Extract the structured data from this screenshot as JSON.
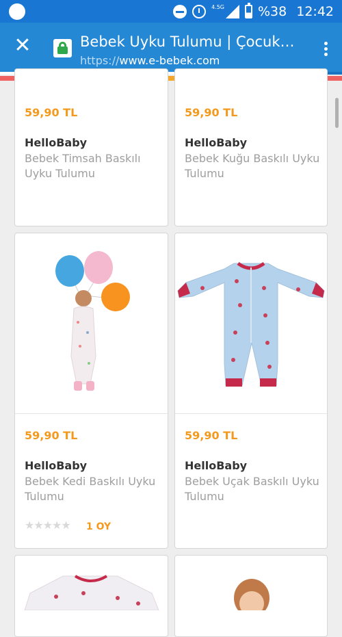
{
  "status_bar": {
    "network": "4.5G",
    "battery": "%38",
    "time": "12:42"
  },
  "browser": {
    "title": "Bebek Uyku Tulumu | Çocuk Uyku Tulumu",
    "url_scheme": "https://",
    "url_host": "www.e-bebek.com",
    "load_progress": 0.71,
    "close_icon": "close-icon",
    "menu_icon": "more-vertical-icon",
    "lock_icon": "lock-icon"
  },
  "brand_colors": {
    "accent_bar": [
      "#f06262",
      "#f06262",
      "#f4a72a",
      "#f06262"
    ],
    "price": "#f39a1e",
    "app_bar": "#2588d4"
  },
  "products": [
    {
      "price": "59,90 TL",
      "brand": "HelloBaby",
      "name": "Bebek Timsah Baskılı Uyku Tulumu"
    },
    {
      "price": "59,90 TL",
      "brand": "HelloBaby",
      "name": "Bebek Kuğu Baskılı Uyku Tulumu"
    },
    {
      "price": "59,90 TL",
      "brand": "HelloBaby",
      "name": "Bebek Kedi Baskılı Uyku Tulumu",
      "rating": {
        "stars": 0,
        "max": 5,
        "votes": "1 OY"
      }
    },
    {
      "price": "59,90 TL",
      "brand": "HelloBaby",
      "name": "Bebek Uçak Baskılı Uyku Tulumu"
    }
  ]
}
